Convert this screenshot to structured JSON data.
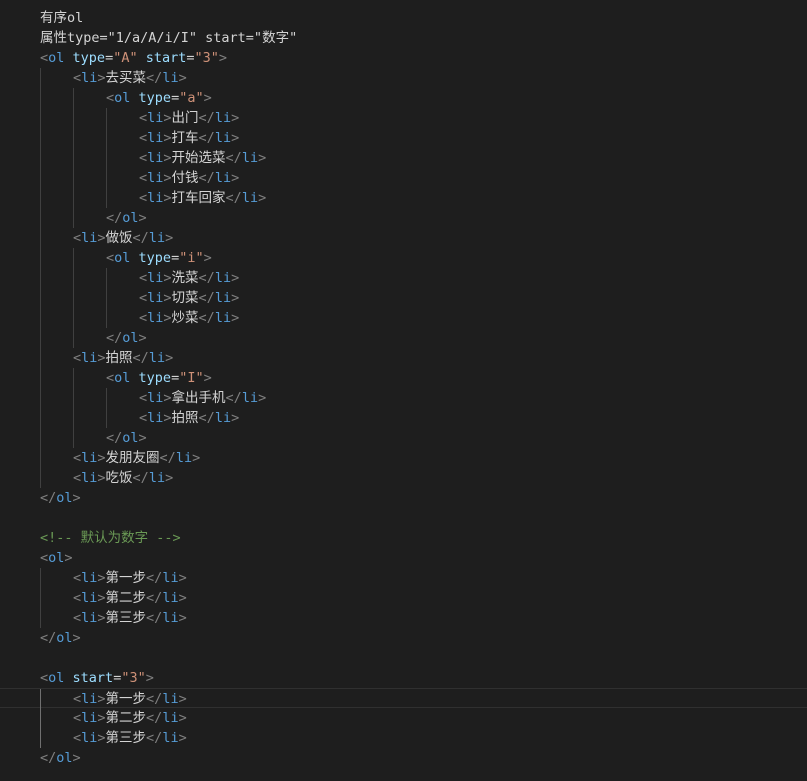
{
  "editor": {
    "background": "#1e1e1e",
    "colors": {
      "punctuation": "#808080",
      "tag": "#569cd6",
      "attribute": "#9cdcfe",
      "string": "#ce9178",
      "text": "#d4d4d4",
      "comment": "#6a9955"
    },
    "current_line": 34,
    "lines": [
      {
        "indent": 0,
        "tokens": [
          [
            "x",
            "有序ol"
          ]
        ]
      },
      {
        "indent": 0,
        "tokens": [
          [
            "x",
            "属性type=\"1/a/A/i/I\" start=\"数字\""
          ]
        ]
      },
      {
        "indent": 0,
        "tokens": [
          [
            "p",
            "<"
          ],
          [
            "t",
            "ol"
          ],
          [
            "x",
            " "
          ],
          [
            "a",
            "type"
          ],
          [
            "x",
            "="
          ],
          [
            "s",
            "\"A\""
          ],
          [
            "x",
            " "
          ],
          [
            "a",
            "start"
          ],
          [
            "x",
            "="
          ],
          [
            "s",
            "\"3\""
          ],
          [
            "p",
            ">"
          ]
        ]
      },
      {
        "indent": 1,
        "tokens": [
          [
            "p",
            "<"
          ],
          [
            "t",
            "li"
          ],
          [
            "p",
            ">"
          ],
          [
            "x",
            "去买菜"
          ],
          [
            "p",
            "</"
          ],
          [
            "t",
            "li"
          ],
          [
            "p",
            ">"
          ]
        ]
      },
      {
        "indent": 2,
        "tokens": [
          [
            "p",
            "<"
          ],
          [
            "t",
            "ol"
          ],
          [
            "x",
            " "
          ],
          [
            "a",
            "type"
          ],
          [
            "x",
            "="
          ],
          [
            "s",
            "\"a\""
          ],
          [
            "p",
            ">"
          ]
        ]
      },
      {
        "indent": 3,
        "tokens": [
          [
            "p",
            "<"
          ],
          [
            "t",
            "li"
          ],
          [
            "p",
            ">"
          ],
          [
            "x",
            "出门"
          ],
          [
            "p",
            "</"
          ],
          [
            "t",
            "li"
          ],
          [
            "p",
            ">"
          ]
        ]
      },
      {
        "indent": 3,
        "tokens": [
          [
            "p",
            "<"
          ],
          [
            "t",
            "li"
          ],
          [
            "p",
            ">"
          ],
          [
            "x",
            "打车"
          ],
          [
            "p",
            "</"
          ],
          [
            "t",
            "li"
          ],
          [
            "p",
            ">"
          ]
        ]
      },
      {
        "indent": 3,
        "tokens": [
          [
            "p",
            "<"
          ],
          [
            "t",
            "li"
          ],
          [
            "p",
            ">"
          ],
          [
            "x",
            "开始选菜"
          ],
          [
            "p",
            "</"
          ],
          [
            "t",
            "li"
          ],
          [
            "p",
            ">"
          ]
        ]
      },
      {
        "indent": 3,
        "tokens": [
          [
            "p",
            "<"
          ],
          [
            "t",
            "li"
          ],
          [
            "p",
            ">"
          ],
          [
            "x",
            "付钱"
          ],
          [
            "p",
            "</"
          ],
          [
            "t",
            "li"
          ],
          [
            "p",
            ">"
          ]
        ]
      },
      {
        "indent": 3,
        "tokens": [
          [
            "p",
            "<"
          ],
          [
            "t",
            "li"
          ],
          [
            "p",
            ">"
          ],
          [
            "x",
            "打车回家"
          ],
          [
            "p",
            "</"
          ],
          [
            "t",
            "li"
          ],
          [
            "p",
            ">"
          ]
        ]
      },
      {
        "indent": 2,
        "tokens": [
          [
            "p",
            "</"
          ],
          [
            "t",
            "ol"
          ],
          [
            "p",
            ">"
          ]
        ]
      },
      {
        "indent": 1,
        "tokens": [
          [
            "p",
            "<"
          ],
          [
            "t",
            "li"
          ],
          [
            "p",
            ">"
          ],
          [
            "x",
            "做饭"
          ],
          [
            "p",
            "</"
          ],
          [
            "t",
            "li"
          ],
          [
            "p",
            ">"
          ]
        ]
      },
      {
        "indent": 2,
        "tokens": [
          [
            "p",
            "<"
          ],
          [
            "t",
            "ol"
          ],
          [
            "x",
            " "
          ],
          [
            "a",
            "type"
          ],
          [
            "x",
            "="
          ],
          [
            "s",
            "\"i\""
          ],
          [
            "p",
            ">"
          ]
        ]
      },
      {
        "indent": 3,
        "tokens": [
          [
            "p",
            "<"
          ],
          [
            "t",
            "li"
          ],
          [
            "p",
            ">"
          ],
          [
            "x",
            "洗菜"
          ],
          [
            "p",
            "</"
          ],
          [
            "t",
            "li"
          ],
          [
            "p",
            ">"
          ]
        ]
      },
      {
        "indent": 3,
        "tokens": [
          [
            "p",
            "<"
          ],
          [
            "t",
            "li"
          ],
          [
            "p",
            ">"
          ],
          [
            "x",
            "切菜"
          ],
          [
            "p",
            "</"
          ],
          [
            "t",
            "li"
          ],
          [
            "p",
            ">"
          ]
        ]
      },
      {
        "indent": 3,
        "tokens": [
          [
            "p",
            "<"
          ],
          [
            "t",
            "li"
          ],
          [
            "p",
            ">"
          ],
          [
            "x",
            "炒菜"
          ],
          [
            "p",
            "</"
          ],
          [
            "t",
            "li"
          ],
          [
            "p",
            ">"
          ]
        ]
      },
      {
        "indent": 2,
        "tokens": [
          [
            "p",
            "</"
          ],
          [
            "t",
            "ol"
          ],
          [
            "p",
            ">"
          ]
        ]
      },
      {
        "indent": 1,
        "tokens": [
          [
            "p",
            "<"
          ],
          [
            "t",
            "li"
          ],
          [
            "p",
            ">"
          ],
          [
            "x",
            "拍照"
          ],
          [
            "p",
            "</"
          ],
          [
            "t",
            "li"
          ],
          [
            "p",
            ">"
          ]
        ]
      },
      {
        "indent": 2,
        "tokens": [
          [
            "p",
            "<"
          ],
          [
            "t",
            "ol"
          ],
          [
            "x",
            " "
          ],
          [
            "a",
            "type"
          ],
          [
            "x",
            "="
          ],
          [
            "s",
            "\"I\""
          ],
          [
            "p",
            ">"
          ]
        ]
      },
      {
        "indent": 3,
        "tokens": [
          [
            "p",
            "<"
          ],
          [
            "t",
            "li"
          ],
          [
            "p",
            ">"
          ],
          [
            "x",
            "拿出手机"
          ],
          [
            "p",
            "</"
          ],
          [
            "t",
            "li"
          ],
          [
            "p",
            ">"
          ]
        ]
      },
      {
        "indent": 3,
        "tokens": [
          [
            "p",
            "<"
          ],
          [
            "t",
            "li"
          ],
          [
            "p",
            ">"
          ],
          [
            "x",
            "拍照"
          ],
          [
            "p",
            "</"
          ],
          [
            "t",
            "li"
          ],
          [
            "p",
            ">"
          ]
        ]
      },
      {
        "indent": 2,
        "tokens": [
          [
            "p",
            "</"
          ],
          [
            "t",
            "ol"
          ],
          [
            "p",
            ">"
          ]
        ]
      },
      {
        "indent": 1,
        "tokens": [
          [
            "p",
            "<"
          ],
          [
            "t",
            "li"
          ],
          [
            "p",
            ">"
          ],
          [
            "x",
            "发朋友圈"
          ],
          [
            "p",
            "</"
          ],
          [
            "t",
            "li"
          ],
          [
            "p",
            ">"
          ]
        ]
      },
      {
        "indent": 1,
        "tokens": [
          [
            "p",
            "<"
          ],
          [
            "t",
            "li"
          ],
          [
            "p",
            ">"
          ],
          [
            "x",
            "吃饭"
          ],
          [
            "p",
            "</"
          ],
          [
            "t",
            "li"
          ],
          [
            "p",
            ">"
          ]
        ]
      },
      {
        "indent": 0,
        "tokens": [
          [
            "p",
            "</"
          ],
          [
            "t",
            "ol"
          ],
          [
            "p",
            ">"
          ]
        ]
      },
      {
        "indent": 0,
        "tokens": []
      },
      {
        "indent": 0,
        "tokens": [
          [
            "c",
            "<!-- 默认为数字 -->"
          ]
        ]
      },
      {
        "indent": 0,
        "tokens": [
          [
            "p",
            "<"
          ],
          [
            "t",
            "ol"
          ],
          [
            "p",
            ">"
          ]
        ]
      },
      {
        "indent": 1,
        "tokens": [
          [
            "p",
            "<"
          ],
          [
            "t",
            "li"
          ],
          [
            "p",
            ">"
          ],
          [
            "x",
            "第一步"
          ],
          [
            "p",
            "</"
          ],
          [
            "t",
            "li"
          ],
          [
            "p",
            ">"
          ]
        ]
      },
      {
        "indent": 1,
        "tokens": [
          [
            "p",
            "<"
          ],
          [
            "t",
            "li"
          ],
          [
            "p",
            ">"
          ],
          [
            "x",
            "第二步"
          ],
          [
            "p",
            "</"
          ],
          [
            "t",
            "li"
          ],
          [
            "p",
            ">"
          ]
        ]
      },
      {
        "indent": 1,
        "tokens": [
          [
            "p",
            "<"
          ],
          [
            "t",
            "li"
          ],
          [
            "p",
            ">"
          ],
          [
            "x",
            "第三步"
          ],
          [
            "p",
            "</"
          ],
          [
            "t",
            "li"
          ],
          [
            "p",
            ">"
          ]
        ]
      },
      {
        "indent": 0,
        "tokens": [
          [
            "p",
            "</"
          ],
          [
            "t",
            "ol"
          ],
          [
            "p",
            ">"
          ]
        ]
      },
      {
        "indent": 0,
        "tokens": []
      },
      {
        "indent": 0,
        "tokens": [
          [
            "p",
            "<"
          ],
          [
            "t",
            "ol"
          ],
          [
            "x",
            " "
          ],
          [
            "a",
            "start"
          ],
          [
            "x",
            "="
          ],
          [
            "s",
            "\"3\""
          ],
          [
            "p",
            ">"
          ]
        ]
      },
      {
        "indent": 1,
        "tokens": [
          [
            "p",
            "<"
          ],
          [
            "t",
            "li"
          ],
          [
            "p",
            ">"
          ],
          [
            "x",
            "第一步"
          ],
          [
            "p",
            "</"
          ],
          [
            "t",
            "li"
          ],
          [
            "p",
            ">"
          ]
        ]
      },
      {
        "indent": 1,
        "tokens": [
          [
            "p",
            "<"
          ],
          [
            "t",
            "li"
          ],
          [
            "p",
            ">"
          ],
          [
            "x",
            "第二步"
          ],
          [
            "p",
            "</"
          ],
          [
            "t",
            "li"
          ],
          [
            "p",
            ">"
          ]
        ]
      },
      {
        "indent": 1,
        "tokens": [
          [
            "p",
            "<"
          ],
          [
            "t",
            "li"
          ],
          [
            "p",
            ">"
          ],
          [
            "x",
            "第三步"
          ],
          [
            "p",
            "</"
          ],
          [
            "t",
            "li"
          ],
          [
            "p",
            ">"
          ]
        ]
      },
      {
        "indent": 0,
        "tokens": [
          [
            "p",
            "</"
          ],
          [
            "t",
            "ol"
          ],
          [
            "p",
            ">"
          ]
        ]
      }
    ]
  }
}
